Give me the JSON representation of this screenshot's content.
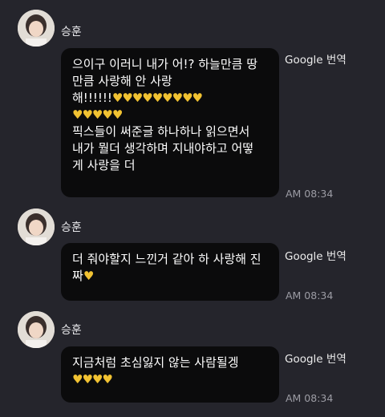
{
  "messages": [
    {
      "sender": "승훈",
      "lines": [
        "으이구 이러니 내가 어!? 하늘만큼 땅",
        "만큼 사랑해 안 사랑",
        "해!!!!!!💛💛💛💛💛💛💛💛💛",
        "💛💛💛💛💛",
        "픽스들이 써준글 하나하나 읽으면서",
        "내가 뭘더 생각하며 지내야하고 어떻",
        "게 사랑을 더"
      ],
      "translate_label": "Google 번역",
      "time": "AM 08:34"
    },
    {
      "sender": "승훈",
      "lines": [
        "더 줘야할지 느낀거 같아 하 사랑해 진",
        "짜💛"
      ],
      "translate_label": "Google 번역",
      "time": "AM 08:34"
    },
    {
      "sender": "승훈",
      "lines": [
        "지금처럼 초심잃지 않는 사람될겡",
        "💛💛💛💛"
      ],
      "translate_label": "Google 번역",
      "time": "AM 08:34"
    }
  ],
  "colors": {
    "background": "#25252c",
    "bubble": "#0b0b0c",
    "heart": "#f1c232"
  },
  "icons": [
    "avatar-photo"
  ]
}
